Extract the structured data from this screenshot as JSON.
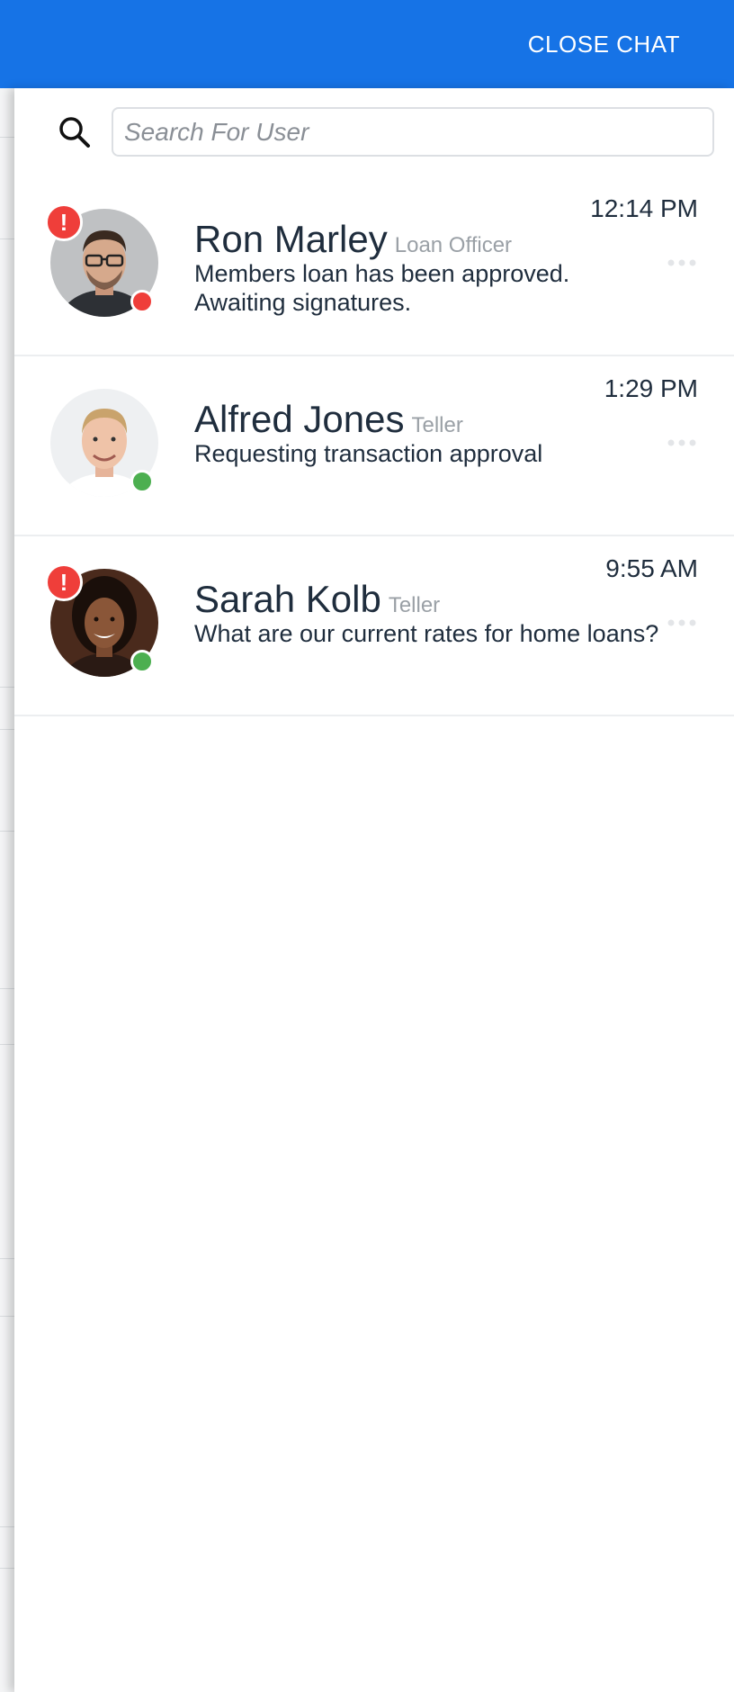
{
  "header": {
    "close_label": "CLOSE CHAT",
    "background_color": "#1673e6"
  },
  "search": {
    "placeholder": "Search For User",
    "value": "",
    "icon": "search-icon"
  },
  "status_colors": {
    "alert": "#ef3e3a",
    "online": "#4caf50",
    "busy": "#ef3e3a"
  },
  "chats": [
    {
      "name": "Ron Marley",
      "role": "Loan Officer",
      "message": "Members loan has been approved. Awaiting signatures.",
      "time": "12:14 PM",
      "alert_mark": "!",
      "status": "busy"
    },
    {
      "name": "Alfred Jones",
      "role": "Teller",
      "message": "Requesting transaction approval",
      "time": "1:29 PM",
      "status": "online"
    },
    {
      "name": "Sarah Kolb",
      "role": "Teller",
      "message": "What are our current rates for home loans?",
      "time": "9:55 AM",
      "alert_mark": "!",
      "status": "online"
    }
  ]
}
